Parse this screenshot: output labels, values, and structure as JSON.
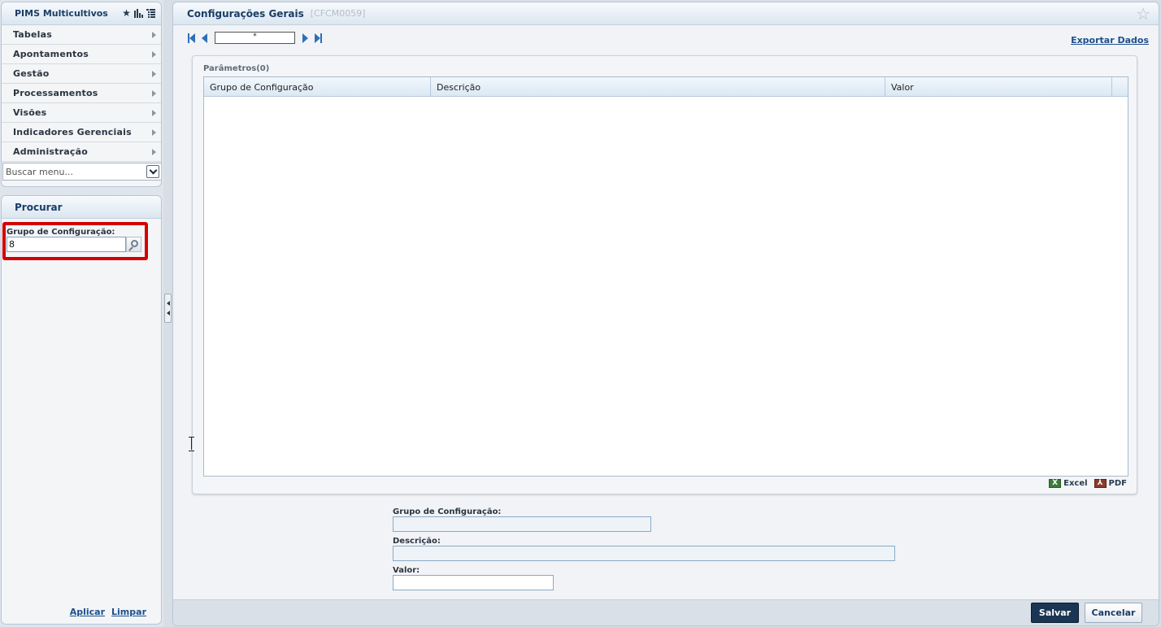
{
  "sidebar": {
    "app_title": "PIMS Multicultivos",
    "header_icons": [
      "star-icon",
      "bar-chart-icon",
      "tree-list-icon"
    ],
    "menu_items": [
      {
        "label": "Tabelas"
      },
      {
        "label": "Apontamentos"
      },
      {
        "label": "Gestão"
      },
      {
        "label": "Processamentos"
      },
      {
        "label": "Visões"
      },
      {
        "label": "Indicadores Gerenciais"
      },
      {
        "label": "Administração"
      }
    ],
    "menu_search_placeholder": "Buscar menu...",
    "search_panel": {
      "title": "Procurar",
      "field_label": "Grupo de Configuração:",
      "field_value": "8",
      "apply_label": "Aplicar",
      "clear_label": "Limpar"
    }
  },
  "main": {
    "title": "Configurações Gerais",
    "code": "[CFCM0059]",
    "nav": {
      "record_value": "*"
    },
    "export_label": "Exportar Dados",
    "params": {
      "title": "Parâmetros(0)",
      "columns": [
        "Grupo de Configuração",
        "Descrição",
        "Valor"
      ],
      "rows": [],
      "excel_label": "Excel",
      "pdf_label": "PDF"
    },
    "form": {
      "group_label": "Grupo de Configuração:",
      "group_value": "",
      "description_label": "Descrição:",
      "description_value": "",
      "value_label": "Valor:",
      "value_value": ""
    },
    "footer": {
      "save_label": "Salvar",
      "cancel_label": "Cancelar"
    }
  },
  "colors": {
    "header_text": "#1a3d66",
    "highlight_border": "#d40000",
    "nav_blue": "#2e6fb8",
    "save_button": "#1b3554"
  }
}
